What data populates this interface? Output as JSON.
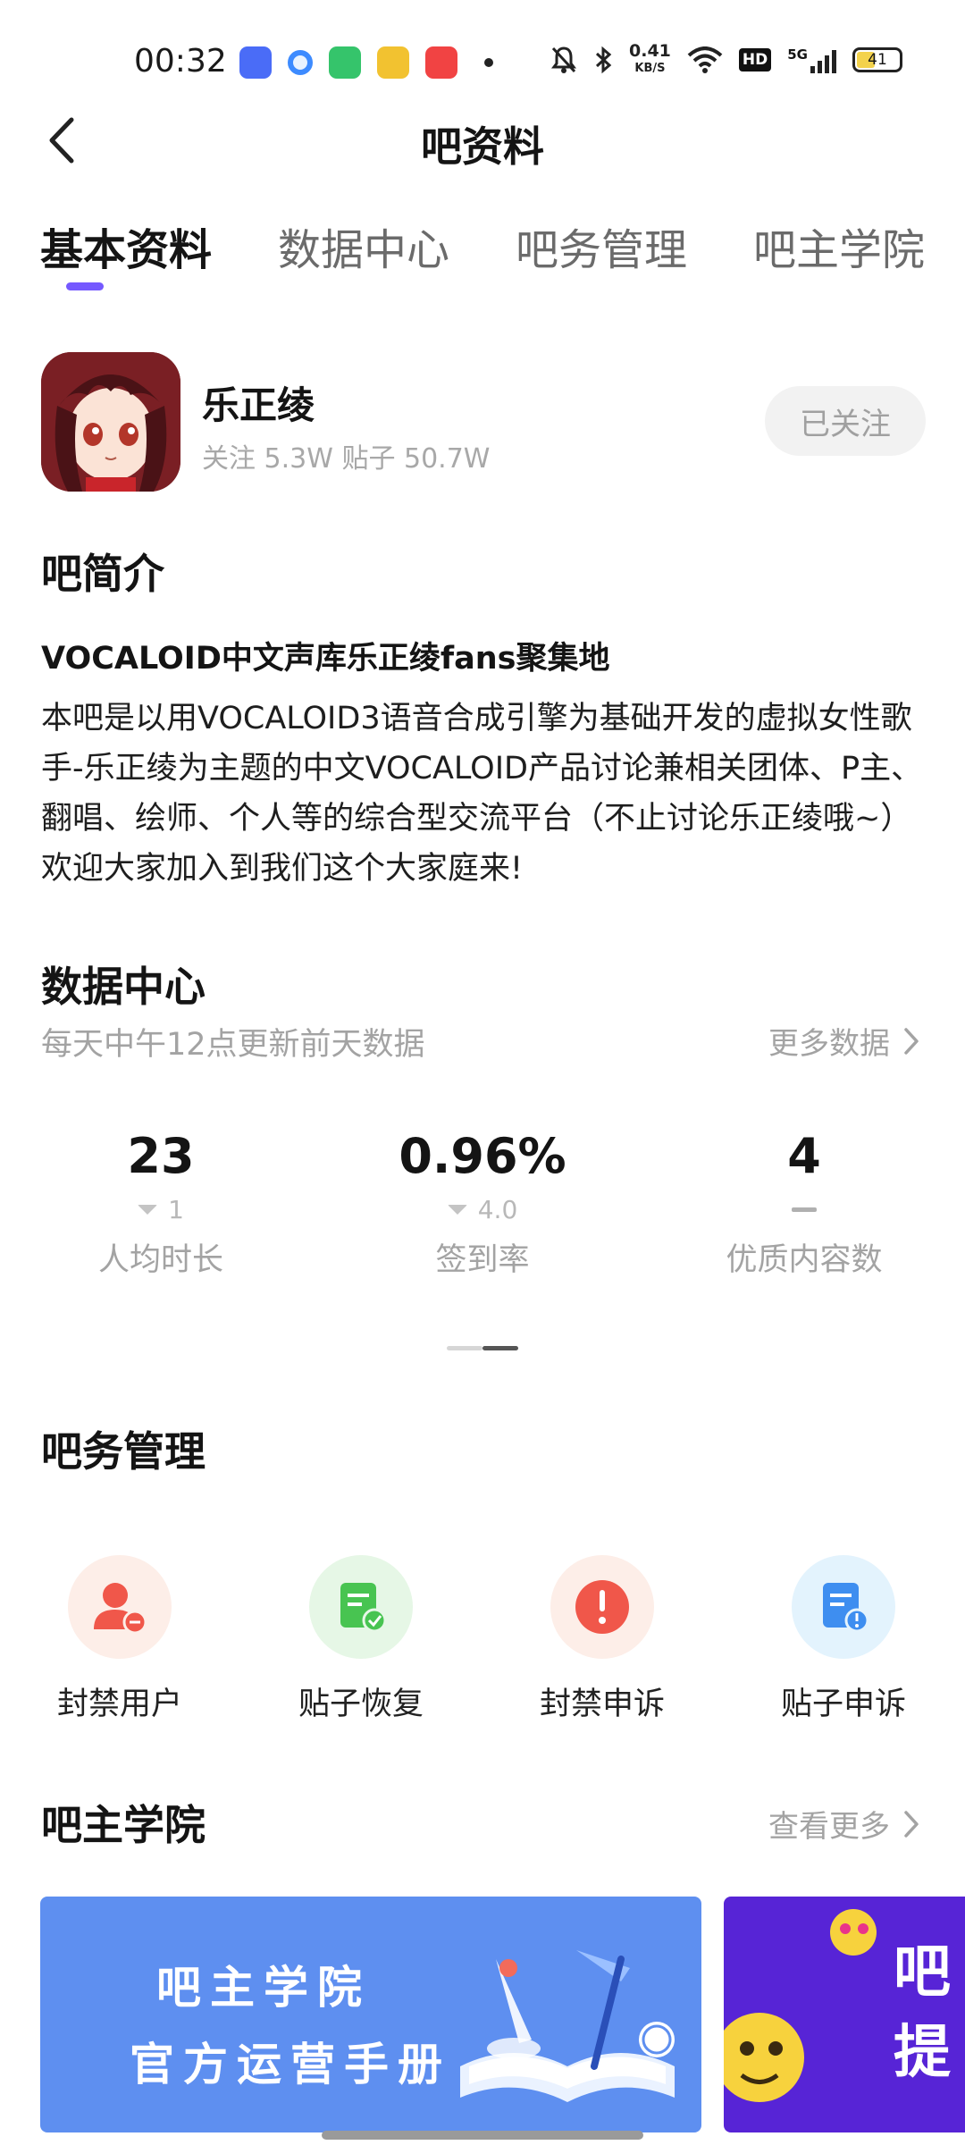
{
  "status_bar": {
    "time": "00:32",
    "net_speed_value": "0.41",
    "net_speed_unit": "KB/S",
    "hd_label": "HD",
    "network_label": "5G",
    "battery": "41"
  },
  "header": {
    "title": "吧资料"
  },
  "tabs": [
    {
      "label": "基本资料",
      "active": true
    },
    {
      "label": "数据中心",
      "active": false
    },
    {
      "label": "吧务管理",
      "active": false
    },
    {
      "label": "吧主学院",
      "active": false
    }
  ],
  "forum": {
    "name": "乐正绫",
    "stats": "关注 5.3W  贴子 50.7W",
    "follow_label": "已关注"
  },
  "intro": {
    "section_title": "吧简介",
    "headline": "VOCALOID中文声库乐正绫fans聚集地",
    "body": "本吧是以用VOCALOID3语音合成引擎为基础开发的虚拟女性歌手-乐正绫为主题的中文VOCALOID产品讨论兼相关团体、P主、翻唱、绘师、个人等的综合型交流平台（不止讨论乐正绫哦~）欢迎大家加入到我们这个大家庭来!"
  },
  "data_center": {
    "section_title": "数据中心",
    "note": "每天中午12点更新前天数据",
    "more_label": "更多数据",
    "stats": [
      {
        "value": "23",
        "change": "1",
        "label": "人均时长"
      },
      {
        "value": "0.96%",
        "change": "4.0",
        "label": "签到率"
      },
      {
        "value": "4",
        "change": "",
        "label": "优质内容数"
      }
    ]
  },
  "management": {
    "section_title": "吧务管理",
    "items": [
      {
        "label": "封禁用户",
        "icon": "ban-user-icon"
      },
      {
        "label": "贴子恢复",
        "icon": "post-restore-icon"
      },
      {
        "label": "封禁申诉",
        "icon": "ban-appeal-icon"
      },
      {
        "label": "贴子申诉",
        "icon": "post-appeal-icon"
      }
    ]
  },
  "academy": {
    "section_title": "吧主学院",
    "more_label": "查看更多",
    "banner1_line1": "吧主学院",
    "banner1_line2": "官方运营手册",
    "banner2_text": "吧\n提"
  },
  "colors": {
    "accent": "#7559ff",
    "banner1": "#5e8ff0",
    "banner2": "#5724d6"
  }
}
